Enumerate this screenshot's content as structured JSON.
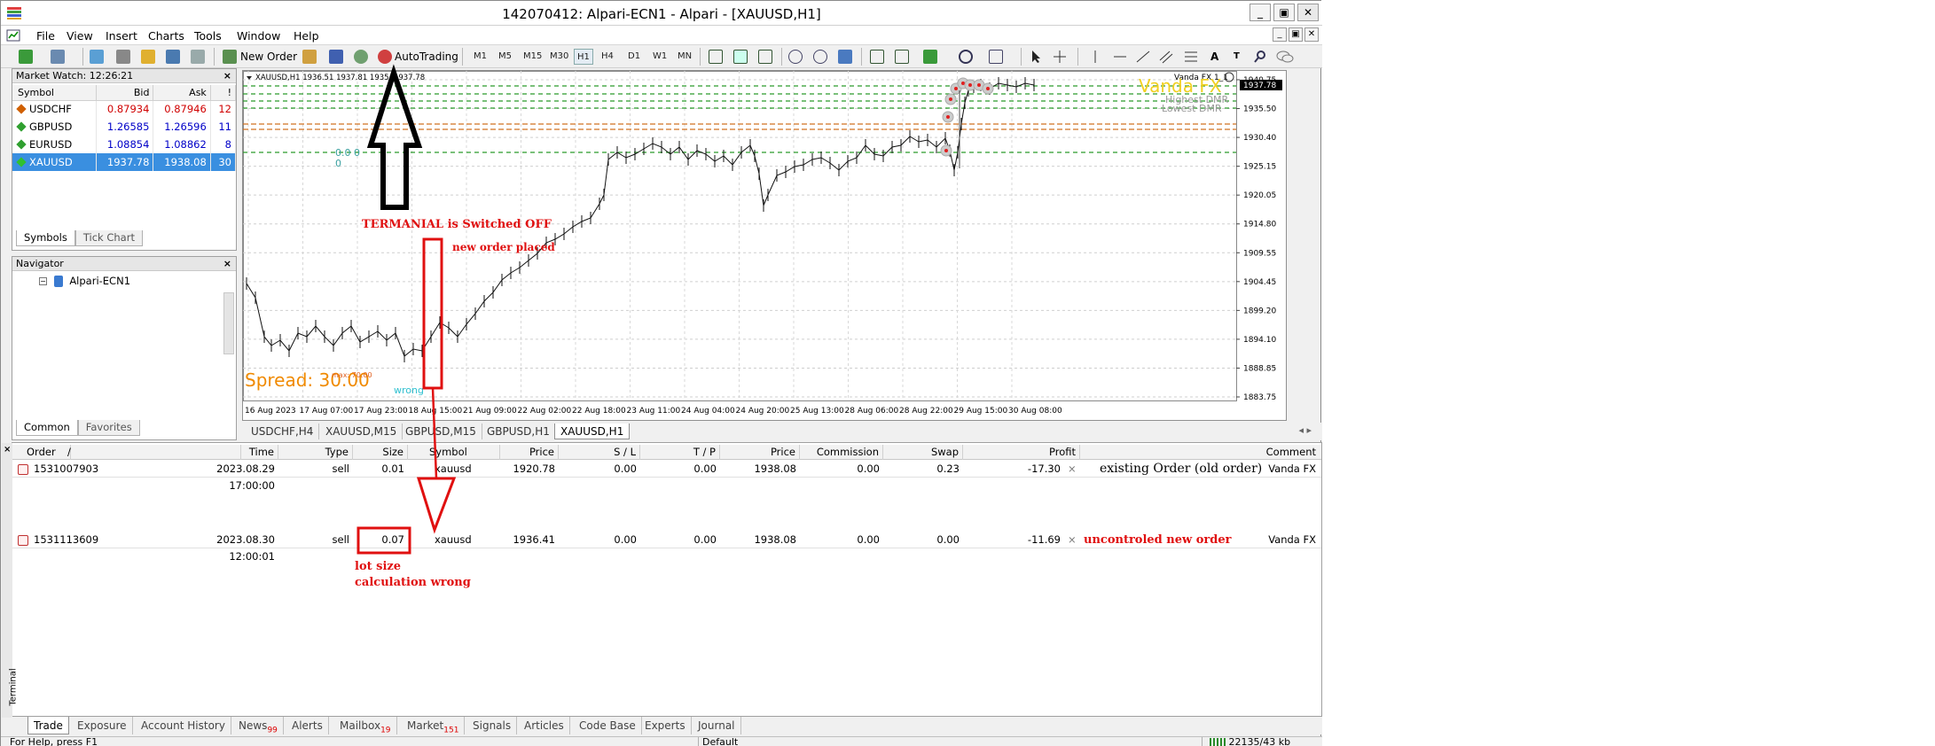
{
  "window": {
    "title": "142070412: Alpari-ECN1 - Alpari - [XAUUSD,H1]",
    "min": "_",
    "max": "▣",
    "close": "✕"
  },
  "menu": [
    "File",
    "View",
    "Insert",
    "Charts",
    "Tools",
    "Window",
    "Help"
  ],
  "mdi": {
    "min": "_",
    "restore": "▣",
    "close": "✕"
  },
  "toolbar": {
    "new_order": "New Order",
    "autotrading": "AutoTrading",
    "timeframes": [
      "M1",
      "M5",
      "M15",
      "M30",
      "H1",
      "H4",
      "D1",
      "W1",
      "MN"
    ],
    "active_tf": "H1"
  },
  "market_watch": {
    "title": "Market Watch: 12:26:21",
    "columns": [
      "Symbol",
      "Bid",
      "Ask",
      "!"
    ],
    "rows": [
      {
        "symbol": "USDCHF",
        "bid": "0.87934",
        "ask": "0.87946",
        "spread": "12",
        "color": "#d00000"
      },
      {
        "symbol": "GBPUSD",
        "bid": "1.26585",
        "ask": "1.26596",
        "spread": "11",
        "color": "#0000c8"
      },
      {
        "symbol": "EURUSD",
        "bid": "1.08854",
        "ask": "1.08862",
        "spread": "8",
        "color": "#0000c8"
      },
      {
        "symbol": "XAUUSD",
        "bid": "1937.78",
        "ask": "1938.08",
        "spread": "30",
        "color": "#ffffff"
      }
    ],
    "tabs": [
      "Symbols",
      "Tick Chart"
    ]
  },
  "navigator": {
    "title": "Navigator",
    "item": "Alpari-ECN1",
    "tabs": [
      "Common",
      "Favorites"
    ]
  },
  "chart": {
    "header": "XAUUSD,H1  1936.51 1937.81 1935.  1937.78",
    "indicator_name": "Vanda FX 1_1",
    "brand": "Vanda FX",
    "brand_color": "#f0d020",
    "label_highest": "Highest DMR",
    "label_lowest": "Lowest DMR",
    "spread_text": "Spread: 30.00",
    "left_value_1": "0.0 0",
    "left_value_2": "0",
    "small_labels": [
      "max: 70.00",
      "wrong"
    ],
    "price_box": "1937.78",
    "y_ticks": [
      "1940.75",
      "1935.50",
      "1930.40",
      "1925.15",
      "1920.05",
      "1914.80",
      "1909.55",
      "1904.45",
      "1899.20",
      "1894.10",
      "1888.85",
      "1883.75"
    ],
    "x_ticks": [
      "16 Aug 2023",
      "17 Aug 07:00",
      "17 Aug 23:00",
      "18 Aug 15:00",
      "21 Aug 09:00",
      "22 Aug 02:00",
      "22 Aug 18:00",
      "23 Aug 11:00",
      "24 Aug 04:00",
      "24 Aug 20:00",
      "25 Aug 13:00",
      "28 Aug 06:00",
      "28 Aug 22:00",
      "29 Aug 15:00",
      "30 Aug 08:00"
    ]
  },
  "chart_tabs": [
    "USDCHF,H4",
    "XAUUSD,M15",
    "GBPUSD,M15",
    "GBPUSD,H1",
    "XAUUSD,H1"
  ],
  "chart_tabs_active": "XAUUSD,H1",
  "orders": {
    "columns": [
      "Order",
      "/",
      "Time",
      "Type",
      "Size",
      "Symbol",
      "Price",
      "S / L",
      "T / P",
      "Price",
      "Commission",
      "Swap",
      "Profit",
      "Comment"
    ],
    "rows": [
      {
        "order": "1531007903",
        "time": "2023.08.29 17:00:00",
        "type": "sell",
        "size": "0.01",
        "symbol": "xauusd",
        "price": "1920.78",
        "sl": "0.00",
        "tp": "0.00",
        "cur_price": "1938.08",
        "commission": "0.00",
        "swap": "0.23",
        "profit": "-17.30",
        "close": "×",
        "comment": "Vanda FX"
      },
      {
        "order": "1531113609",
        "time": "2023.08.30 12:00:01",
        "type": "sell",
        "size": "0.07",
        "symbol": "xauusd",
        "price": "1936.41",
        "sl": "0.00",
        "tp": "0.00",
        "cur_price": "1938.08",
        "commission": "0.00",
        "swap": "0.00",
        "profit": "-11.69",
        "close": "×",
        "comment": "Vanda FX"
      }
    ]
  },
  "annotations": {
    "terminal_off": "TERMANIAL is Switched OFF",
    "new_order": "new order placed",
    "existing_order": "existing Order (old order)",
    "uncontrolled": "uncontroled new order",
    "lot_size_1": "lot size",
    "lot_size_2": "calculation wrong"
  },
  "terminal": {
    "side_label": "Terminal",
    "tabs": [
      {
        "label": "Trade",
        "badge": ""
      },
      {
        "label": "Exposure",
        "badge": ""
      },
      {
        "label": "Account History",
        "badge": ""
      },
      {
        "label": "News",
        "badge": "99"
      },
      {
        "label": "Alerts",
        "badge": ""
      },
      {
        "label": "Mailbox",
        "badge": "19"
      },
      {
        "label": "Market",
        "badge": "151"
      },
      {
        "label": "Signals",
        "badge": ""
      },
      {
        "label": "Articles",
        "badge": ""
      },
      {
        "label": "Code Base",
        "badge": ""
      },
      {
        "label": "Experts",
        "badge": ""
      },
      {
        "label": "Journal",
        "badge": ""
      }
    ]
  },
  "status": {
    "help": "For Help, press F1",
    "profile": "Default",
    "traffic": "22135/43 kb"
  }
}
